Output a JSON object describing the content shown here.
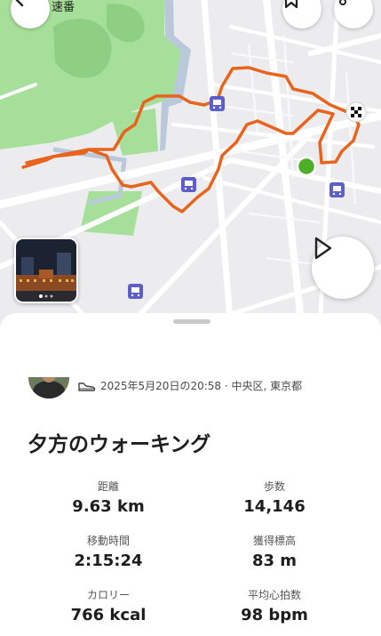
{
  "activity": {
    "meta": "2025年5月20日の20:58 · 中央区, 東京都",
    "title": "夕方のウォーキング"
  },
  "stats": [
    {
      "label": "距離",
      "value": "9.63 km"
    },
    {
      "label": "歩数",
      "value": "14,146"
    },
    {
      "label": "移動時間",
      "value": "2:15:24"
    },
    {
      "label": "獲得標高",
      "value": "83 m"
    },
    {
      "label": "カロリー",
      "value": "766 kcal"
    },
    {
      "label": "平均心拍数",
      "value": "98 bpm"
    }
  ],
  "map": {
    "partial_label": "速番",
    "route_color": "#e8631c",
    "start_color": "#4caf27",
    "park_color": "#a6df9a",
    "icons": [
      "back-icon",
      "bookmark-icon",
      "more-icon",
      "play-icon",
      "shoe-icon",
      "finish-flag-icon",
      "train-station-icon"
    ]
  }
}
